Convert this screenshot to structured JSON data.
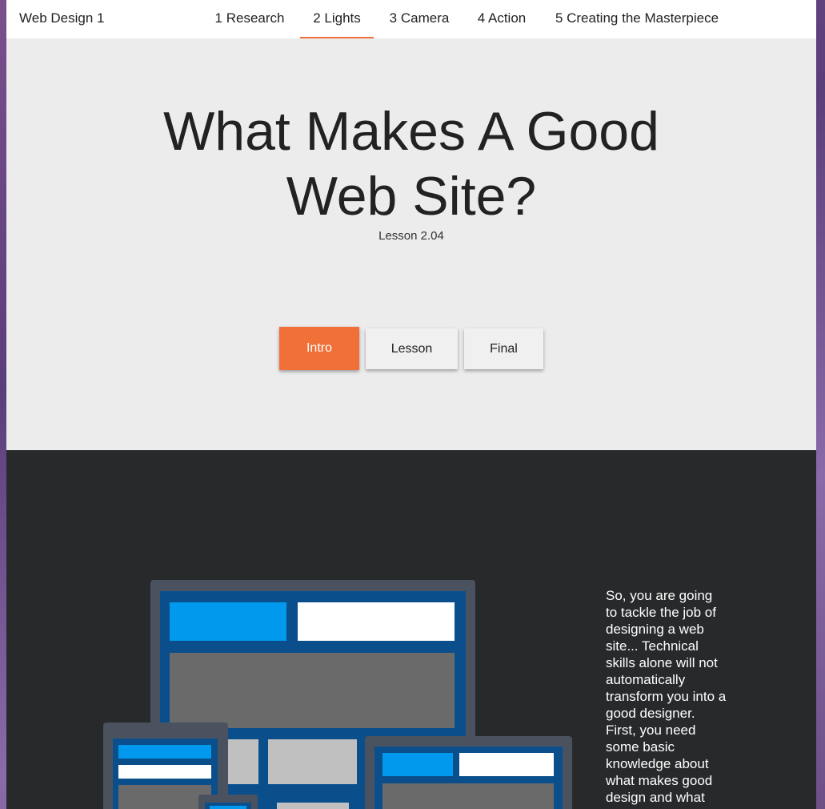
{
  "navbar": {
    "brand": "Web Design 1",
    "items": [
      {
        "label": "1 Research"
      },
      {
        "label": "2 Lights",
        "active": true
      },
      {
        "label": "3 Camera"
      },
      {
        "label": "4 Action"
      },
      {
        "label": "5 Creating the Masterpiece"
      }
    ]
  },
  "hero": {
    "title_line1": "What Makes A Good",
    "title_line2": "Web Site?",
    "subtitle": "Lesson 2.04"
  },
  "section_buttons": [
    {
      "label": "Intro",
      "active": true
    },
    {
      "label": "Lesson"
    },
    {
      "label": "Final"
    }
  ],
  "intro": {
    "text": "So, you are going to tackle the job of designing a web site... Technical skills alone will not automatically transform you into a good designer. First, you need some basic knowledge about what makes good design and what falls into the"
  },
  "colors": {
    "accent": "#f07038",
    "dark_section": "#28292b",
    "device_frame": "#4a5260",
    "screen_blue": "#0a4f8c",
    "bright_blue": "#0099ee"
  }
}
